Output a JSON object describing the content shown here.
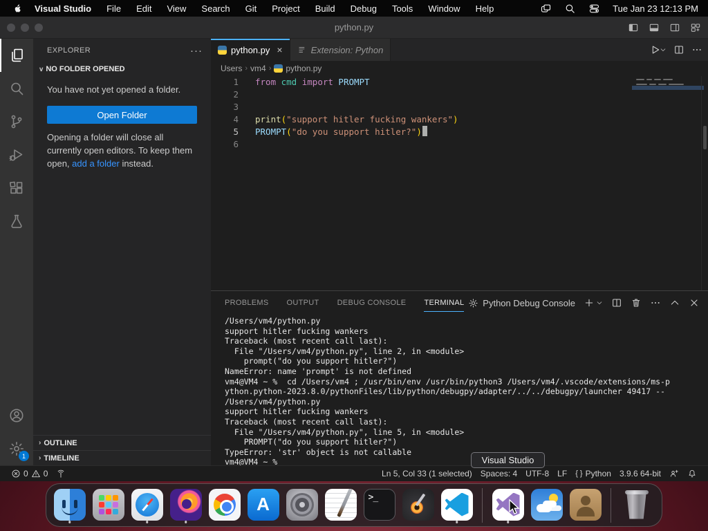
{
  "menubar": {
    "items": [
      "Visual Studio",
      "File",
      "Edit",
      "View",
      "Search",
      "Git",
      "Project",
      "Build",
      "Debug",
      "Tools",
      "Window",
      "Help"
    ],
    "status_icons": [
      "window-switcher-icon",
      "search-icon",
      "control-center-icon"
    ],
    "clock": "Tue Jan 23  12:13 PM"
  },
  "window": {
    "title": "python.py"
  },
  "activity_bar": {
    "top": [
      {
        "name": "explorer",
        "active": true
      },
      {
        "name": "search",
        "active": false
      },
      {
        "name": "source-control",
        "active": false
      },
      {
        "name": "run-and-debug",
        "active": false
      },
      {
        "name": "extensions",
        "active": false
      },
      {
        "name": "testing",
        "active": false
      }
    ],
    "bottom": [
      {
        "name": "accounts",
        "active": false
      },
      {
        "name": "settings",
        "active": false,
        "badge": "1"
      }
    ]
  },
  "sidebar": {
    "title": "EXPLORER",
    "more_label": "···",
    "section": "NO FOLDER OPENED",
    "empty_text": "You have not yet opened a folder.",
    "open_folder_label": "Open Folder",
    "note_before": "Opening a folder will close all currently open editors. To keep them open, ",
    "note_link": "add a folder",
    "note_after": " instead.",
    "bottom_sections": [
      "OUTLINE",
      "TIMELINE"
    ]
  },
  "editor": {
    "tabs": [
      {
        "label": "python.py",
        "icon": "python-icon",
        "active": true,
        "close": "×",
        "italic": false
      },
      {
        "label": "Extension: Python",
        "icon": "list-icon",
        "active": false,
        "close": "",
        "italic": true
      }
    ],
    "breadcrumbs": [
      "Users",
      "vm4",
      "python.py"
    ],
    "lines": [
      {
        "n": "1",
        "tokens": [
          [
            "from",
            "kw"
          ],
          [
            " cmd",
            "mod"
          ],
          [
            " import",
            "kw"
          ],
          [
            " PROMPT",
            "var"
          ]
        ],
        "caret": false
      },
      {
        "n": "2",
        "tokens": [],
        "caret": false
      },
      {
        "n": "3",
        "tokens": [],
        "caret": false
      },
      {
        "n": "4",
        "tokens": [
          [
            "print",
            "fn"
          ],
          [
            "(",
            "paren"
          ],
          [
            "\"support hitler fucking wankers\"",
            "str"
          ],
          [
            ")",
            "paren"
          ]
        ],
        "caret": false
      },
      {
        "n": "5",
        "tokens": [
          [
            "PROMPT",
            "var"
          ],
          [
            "(",
            "paren"
          ],
          [
            "\"do you support hitler?\"",
            "str"
          ],
          [
            ")",
            "paren"
          ]
        ],
        "caret": true
      },
      {
        "n": "6",
        "tokens": [],
        "caret": false
      }
    ]
  },
  "panel": {
    "tabs": [
      {
        "label": "PROBLEMS",
        "active": false
      },
      {
        "label": "OUTPUT",
        "active": false
      },
      {
        "label": "DEBUG CONSOLE",
        "active": false
      },
      {
        "label": "TERMINAL",
        "active": true
      }
    ],
    "console_label": "Python Debug Console",
    "terminal_lines": [
      "/Users/vm4/python.py",
      "support hitler fucking wankers",
      "Traceback (most recent call last):",
      "  File \"/Users/vm4/python.py\", line 2, in <module>",
      "    prompt(\"do you support hitler?\")",
      "NameError: name 'prompt' is not defined",
      "vm4@VM4 ~ %  cd /Users/vm4 ; /usr/bin/env /usr/bin/python3 /Users/vm4/.vscode/extensions/ms-p",
      "ython.python-2023.8.0/pythonFiles/lib/python/debugpy/adapter/../../debugpy/launcher 49417 --",
      "/Users/vm4/python.py",
      "support hitler fucking wankers",
      "Traceback (most recent call last):",
      "  File \"/Users/vm4/python.py\", line 5, in <module>",
      "    PROMPT(\"do you support hitler?\")",
      "TypeError: 'str' object is not callable",
      "vm4@VM4 ~ %"
    ]
  },
  "status_bar": {
    "errors": "0",
    "warnings": "0",
    "cursor": "Ln 5, Col 33 (1 selected)",
    "spaces": "Spaces: 4",
    "encoding": "UTF-8",
    "eol": "LF",
    "braces": "{ }",
    "language": "Python",
    "runtime": "3.9.6 64-bit"
  },
  "tooltip": "Visual Studio",
  "dock": {
    "items": [
      {
        "name": "finder",
        "running": true
      },
      {
        "name": "launchpad",
        "running": false
      },
      {
        "name": "safari",
        "running": true
      },
      {
        "name": "firefox",
        "running": true
      },
      {
        "name": "chrome",
        "running": false
      },
      {
        "name": "app-store",
        "running": false
      },
      {
        "name": "system-settings",
        "running": false
      },
      {
        "name": "textedit",
        "running": false
      },
      {
        "name": "terminal",
        "running": false
      },
      {
        "name": "garageband",
        "running": false
      },
      {
        "name": "vscode",
        "running": true
      },
      {
        "divider": true
      },
      {
        "name": "visual-studio",
        "running": true
      },
      {
        "name": "weather",
        "running": false
      },
      {
        "name": "contacts",
        "running": false
      },
      {
        "divider": true
      },
      {
        "name": "trash",
        "running": false
      }
    ]
  },
  "colors": {
    "kw": "#c586c0",
    "mod": "#4ec9b0",
    "var": "#9cdcfe",
    "fn": "#dcdcaa",
    "paren": "#ffd710",
    "str": "#ce9178",
    "accent_button": "#0e7ad3",
    "tab_accent": "#4db2ff",
    "link": "#3794ff",
    "badge": "#0078d4"
  }
}
